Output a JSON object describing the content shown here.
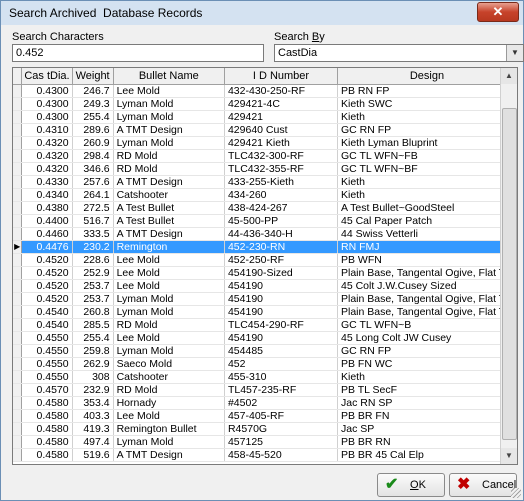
{
  "window": {
    "title": "Search Archived  Database Records",
    "close_glyph": "✕"
  },
  "search": {
    "label": "Search Characters",
    "value": "0.452"
  },
  "search_by": {
    "label_prefix": "Search ",
    "label_underline": "B",
    "label_suffix": "y",
    "value": "CastDia"
  },
  "table": {
    "columns": [
      "Cas tDia.",
      "Weight",
      "Bullet Name",
      "I D Number",
      "Design"
    ],
    "selected_index": 12,
    "rows": [
      [
        "0.4300",
        "246.7",
        "Lee Mold",
        "432-430-250-RF",
        "PB RN FP"
      ],
      [
        "0.4300",
        "249.3",
        "Lyman Mold",
        "429421-4C",
        "Kieth SWC"
      ],
      [
        "0.4300",
        "255.4",
        "Lyman Mold",
        "429421",
        "Kieth"
      ],
      [
        "0.4310",
        "289.6",
        "A TMT Design",
        "429640 Cust",
        "GC RN FP"
      ],
      [
        "0.4320",
        "260.9",
        "Lyman Mold",
        "429421 Kieth",
        "Kieth Lyman Bluprint"
      ],
      [
        "0.4320",
        "298.4",
        "RD Mold",
        "TLC432-300-RF",
        "GC TL WFN~FB"
      ],
      [
        "0.4320",
        "346.6",
        "RD Mold",
        "TLC432-355-RF",
        "GC TL WFN~BF"
      ],
      [
        "0.4330",
        "257.6",
        "A TMT Design",
        "433-255-Kieth",
        "Kieth"
      ],
      [
        "0.4340",
        "264.1",
        "Catshooter",
        "434-260",
        "Kieth"
      ],
      [
        "0.4380",
        "272.5",
        "A Test Bullet",
        "438-424-267",
        "A Test Bullet~GoodSteel"
      ],
      [
        "0.4400",
        "516.7",
        "A Test Bullet",
        "45-500-PP",
        "45 Cal Paper Patch"
      ],
      [
        "0.4460",
        "333.5",
        "A TMT Design",
        "44-436-340-H",
        "44 Swiss Vetterli"
      ],
      [
        "0.4476",
        "230.2",
        "Remington",
        "452-230-RN",
        "RN FMJ"
      ],
      [
        "0.4520",
        "228.6",
        "Lee Mold",
        "452-250-RF",
        "PB WFN"
      ],
      [
        "0.4520",
        "252.9",
        "Lee Mold",
        "454190-Sized",
        "Plain Base, Tangental Ogive, Flat Tip"
      ],
      [
        "0.4520",
        "253.7",
        "Lee Mold",
        "454190",
        "45 Colt J.W.Cusey Sized"
      ],
      [
        "0.4520",
        "253.7",
        "Lyman Mold",
        "454190",
        "Plain Base, Tangental Ogive, Flat Tip"
      ],
      [
        "0.4540",
        "260.8",
        "Lyman Mold",
        "454190",
        "Plain Base, Tangental Ogive, Flat Tip"
      ],
      [
        "0.4540",
        "285.5",
        "RD Mold",
        "TLC454-290-RF",
        "GC TL WFN~B"
      ],
      [
        "0.4550",
        "255.4",
        "Lee Mold",
        "454190",
        "45 Long Colt JW Cusey"
      ],
      [
        "0.4550",
        "259.8",
        "Lyman Mold",
        "454485",
        "GC RN FP"
      ],
      [
        "0.4550",
        "262.9",
        "Saeco Mold",
        "452",
        "PB FN WC"
      ],
      [
        "0.4550",
        "308",
        "Catshooter",
        "455-310",
        "Kieth"
      ],
      [
        "0.4570",
        "232.9",
        "RD Mold",
        "TL457-235-RF",
        "PB TL SecF"
      ],
      [
        "0.4580",
        "353.4",
        "Hornady",
        "#4502",
        "Jac RN SP"
      ],
      [
        "0.4580",
        "403.3",
        "Lee Mold",
        "457-405-RF",
        "PB BR FN"
      ],
      [
        "0.4580",
        "419.3",
        "Remington Bullet",
        "R4570G",
        "Jac SP"
      ],
      [
        "0.4580",
        "497.4",
        "Lyman Mold",
        "457125",
        "PB BR RN"
      ],
      [
        "0.4580",
        "519.6",
        "A TMT Design",
        "458-45-520",
        "PB BR 45 Cal Elp"
      ]
    ]
  },
  "buttons": {
    "ok": {
      "label_underline": "O",
      "label_rest": "K",
      "icon": "✔",
      "icon_color": "#1a8a1a"
    },
    "cancel": {
      "label": "Cancel",
      "icon": "✖",
      "icon_color": "#c00000"
    }
  },
  "colors": {
    "selection": "#3399ff",
    "title_bar": "#d4e2f1"
  }
}
